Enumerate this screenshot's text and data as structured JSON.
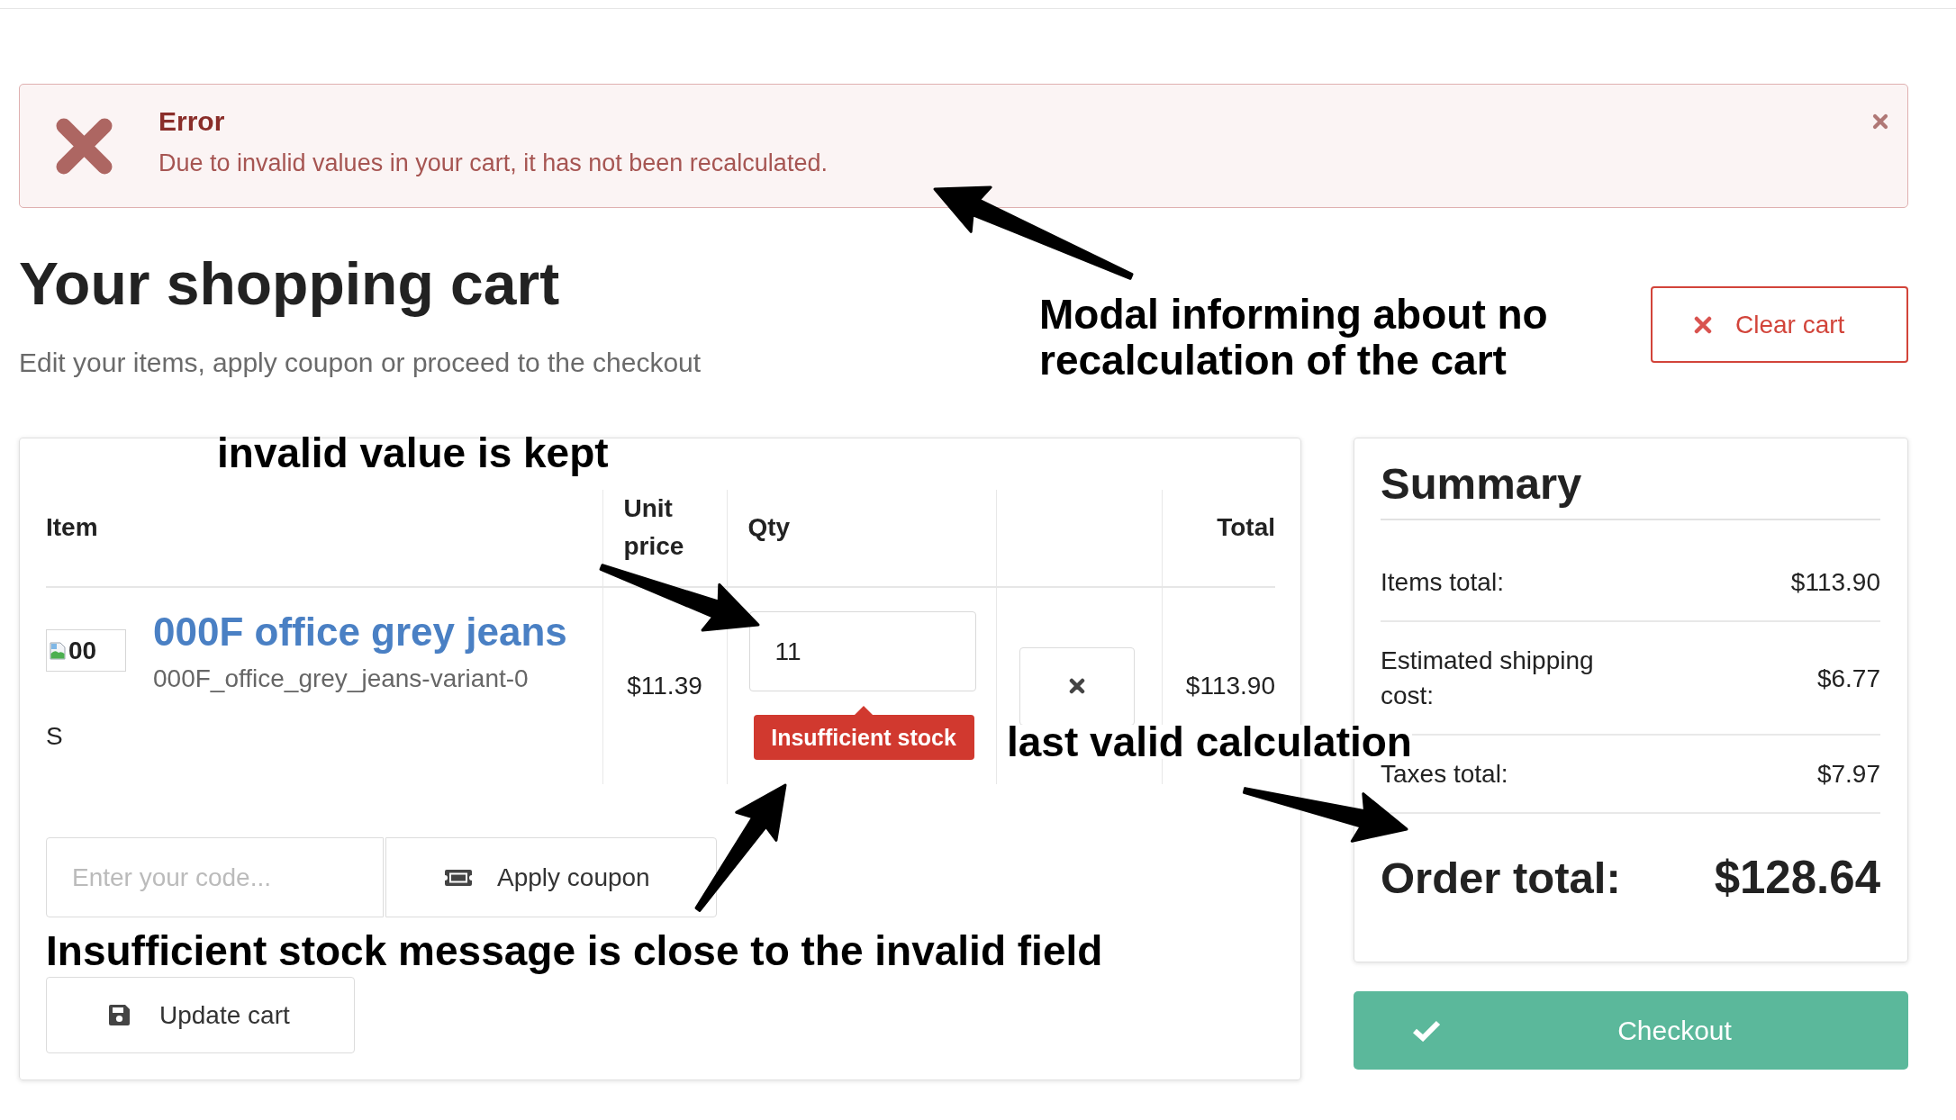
{
  "alert": {
    "title": "Error",
    "message": "Due to invalid values in your cart, it has not been recalculated."
  },
  "header": {
    "title": "Your shopping cart",
    "subtitle": "Edit your items, apply coupon or proceed to the checkout",
    "clear_button": "Clear cart"
  },
  "cart": {
    "columns": [
      "Item",
      "Unit price",
      "Qty",
      "Total"
    ],
    "rows": [
      {
        "image_alt": "00",
        "name": "000F office grey jeans",
        "variant": "000F_office_grey_jeans-variant-0",
        "size": "S",
        "unit_price": "$11.39",
        "qty": "11",
        "error": "Insufficient stock",
        "total": "$113.90"
      }
    ],
    "coupon": {
      "placeholder": "Enter your code...",
      "button": "Apply coupon"
    },
    "update_button": "Update cart"
  },
  "summary": {
    "title": "Summary",
    "lines": [
      {
        "label": "Items total:",
        "value": "$113.90"
      },
      {
        "label": "Estimated shipping cost:",
        "value": "$6.77"
      },
      {
        "label": "Taxes total:",
        "value": "$7.97"
      }
    ],
    "total": {
      "label": "Order total:",
      "value": "$128.64"
    },
    "checkout_button": "Checkout"
  },
  "annotations": [
    {
      "text": "Modal informing about no recalculation of the cart"
    },
    {
      "text": "invalid value is kept"
    },
    {
      "text": "last valid calculation"
    },
    {
      "text": "Insufficient stock message is close to the invalid field"
    }
  ]
}
